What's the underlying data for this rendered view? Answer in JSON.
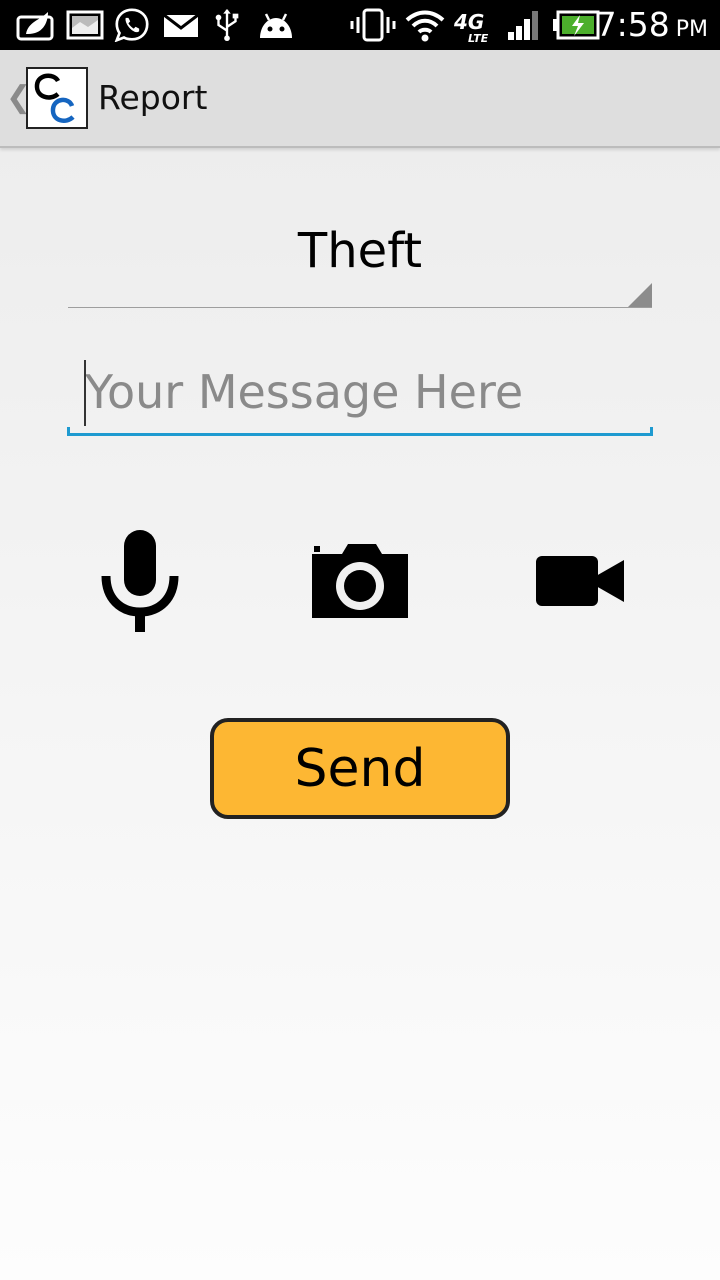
{
  "status_bar": {
    "time": "7:58",
    "ampm": "PM",
    "network_label": "4G",
    "network_sub": "LTE",
    "icons": [
      "leaf-notification-icon",
      "gallery-notification-icon",
      "whatsapp-icon",
      "mail-icon",
      "usb-icon",
      "android-debug-icon",
      "vibrate-icon",
      "wifi-icon",
      "4g-lte-icon",
      "cell-signal-icon",
      "battery-charging-icon"
    ]
  },
  "action_bar": {
    "logo_letters": "CC",
    "title": "Report"
  },
  "report_form": {
    "category_selected": "Theft",
    "message_placeholder": "Your Message Here",
    "message_value": "",
    "media_buttons": [
      "microphone-icon",
      "camera-icon",
      "video-camera-icon"
    ],
    "send_label": "Send"
  },
  "colors": {
    "accent_input": "#1e9ad0",
    "send_button": "#fdb733",
    "status_bar": "#000000",
    "action_bar": "#dedede"
  }
}
